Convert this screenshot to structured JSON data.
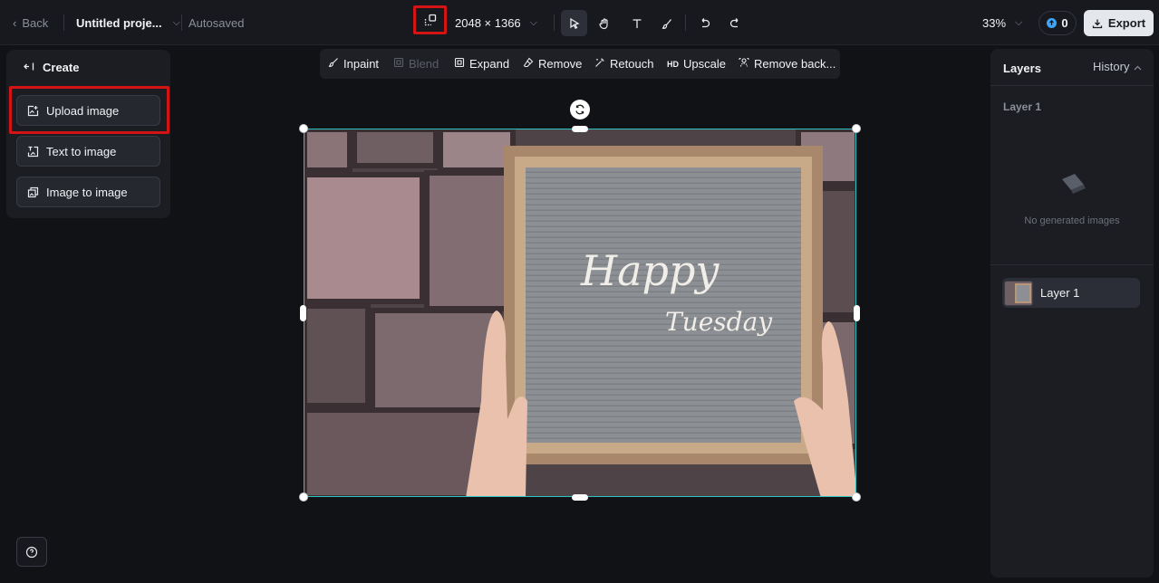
{
  "topbar": {
    "back_label": "Back",
    "project_name": "Untitled proje...",
    "autosave_status": "Autosaved",
    "canvas_size": "2048 × 1366",
    "zoom": "33%",
    "credits": "0",
    "export_label": "Export"
  },
  "tools": {
    "select": "select-arrow-icon",
    "pan": "hand-icon",
    "text": "text-icon",
    "brush": "brush-icon",
    "undo": "undo-icon",
    "redo": "redo-icon"
  },
  "edit_toolbar": {
    "inpaint": "Inpaint",
    "blend": "Blend",
    "expand": "Expand",
    "remove": "Remove",
    "retouch": "Retouch",
    "upscale_prefix": "HD",
    "upscale": "Upscale",
    "remove_bg": "Remove back..."
  },
  "left_panel": {
    "title": "Create",
    "items": [
      {
        "label": "Upload image"
      },
      {
        "label": "Text to image"
      },
      {
        "label": "Image to image"
      }
    ]
  },
  "canvas": {
    "sign_line1": "Happy",
    "sign_line2": "Tuesday"
  },
  "right_panel": {
    "layers_tab": "Layers",
    "history_tab": "History",
    "group_title": "Layer 1",
    "empty_text": "No generated images",
    "layer_item": "Layer 1"
  },
  "colors": {
    "accent_highlight": "#d41414",
    "selection": "#2ec4c4",
    "credit_dot": "#3aa6ff"
  }
}
